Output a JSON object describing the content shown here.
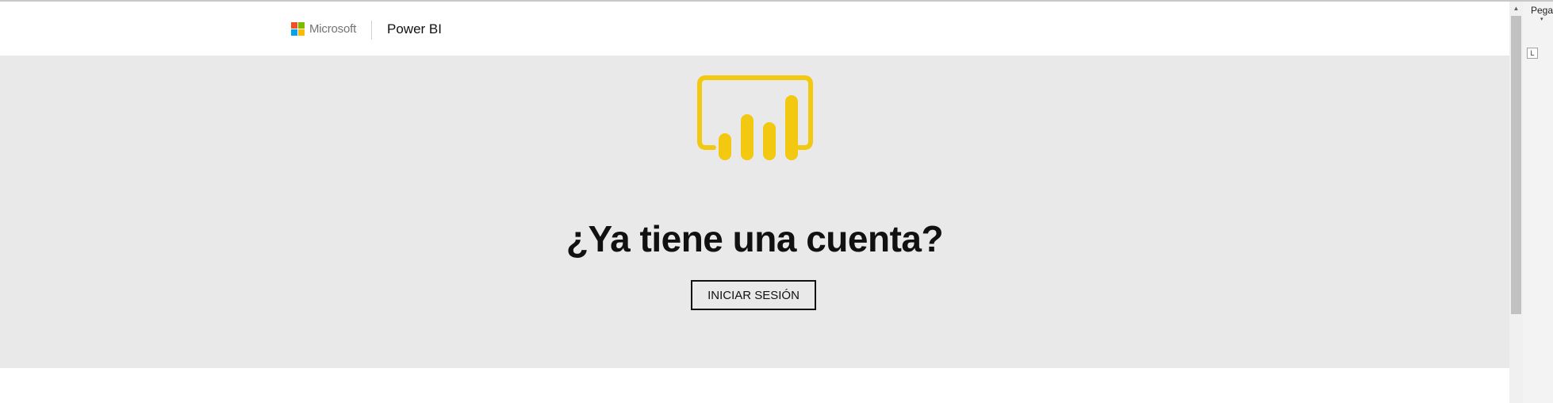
{
  "header": {
    "brand": "Microsoft",
    "product": "Power BI",
    "brand_colors": [
      "#f25022",
      "#7fba00",
      "#00a4ef",
      "#ffb900"
    ]
  },
  "hero": {
    "logo_icon": "power-bi-logo",
    "logo_color": "#f2c811",
    "title": "¿Ya tiene una cuenta?",
    "signin_label": "INICIAR SESIÓN"
  },
  "scrollbar": {
    "up_arrow": "▲"
  },
  "side_panel": {
    "paste_label": "Pegar",
    "paste_caret": "▾",
    "tab_stop_glyph": "L"
  }
}
